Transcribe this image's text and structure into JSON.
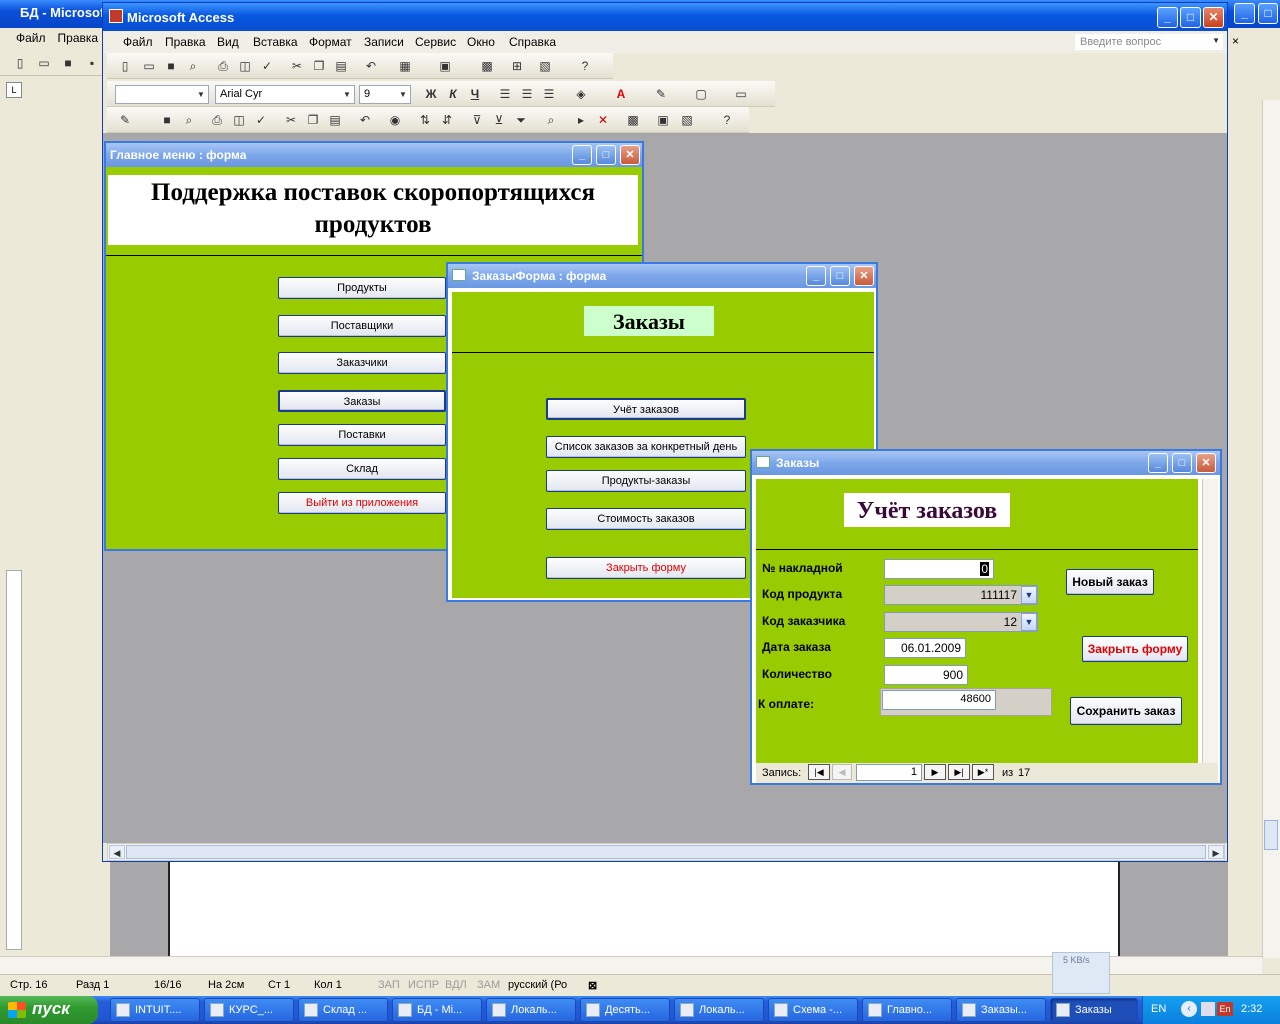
{
  "word": {
    "title": "БД - Microsof",
    "menu": [
      "Файл",
      "Правка"
    ],
    "status": {
      "page": "Стр. 16",
      "section": "Разд 1",
      "pages": "16/16",
      "at": "На 2см",
      "line": "Ст 1",
      "col": "Кол 1",
      "rec": "ЗАП",
      "trk": "ИСПР",
      "ext": "ВДЛ",
      "ovr": "ЗАМ",
      "lang": "русский (Ро"
    }
  },
  "access": {
    "title": "Microsoft Access",
    "menu": [
      "Файл",
      "Правка",
      "Вид",
      "Вставка",
      "Формат",
      "Записи",
      "Сервис",
      "Окно",
      "Справка"
    ],
    "search_placeholder": "Введите вопрос",
    "font_name": "Arial Cyr",
    "font_size": "9",
    "bold": "Ж",
    "italic": "К",
    "underline": "Ч"
  },
  "main_form": {
    "title": "Главное меню : форма",
    "heading": "Поддержка поставок скоропортящихся продуктов",
    "buttons": [
      "Продукты",
      "Поставщики",
      "Заказчики",
      "Заказы",
      "Поставки",
      "Склад",
      "Выйти из приложения"
    ]
  },
  "orders_form": {
    "title": "ЗаказыФорма : форма",
    "heading": "Заказы",
    "buttons": [
      "Учёт заказов",
      "Список заказов за конкретный день",
      "Продукты-заказы",
      "Стоимость заказов",
      "Закрыть форму"
    ]
  },
  "orders_window": {
    "title": "Заказы",
    "heading": "Учёт заказов",
    "labels": {
      "invoice": "№ накладной",
      "product": "Код продукта",
      "customer": "Код заказчика",
      "date": "Дата заказа",
      "qty": "Количество",
      "pay": "К оплате:"
    },
    "values": {
      "invoice": "0",
      "product": "111117",
      "customer": "12",
      "date": "06.01.2009",
      "qty": "900",
      "pay": "48600"
    },
    "buttons": {
      "new": "Новый заказ",
      "close": "Закрыть форму",
      "save": "Сохранить заказ"
    },
    "nav": {
      "label": "Запись:",
      "current": "1",
      "of": "из",
      "total": "17"
    }
  },
  "taskbar": {
    "start": "пуск",
    "tasks": [
      "INTUIT....",
      "КУРС_...",
      "Склад ...",
      "БД - Mi...",
      "Локаль...",
      "Десять...",
      "Локаль...",
      "Схема -...",
      "Главно...",
      "Заказы...",
      "Заказы"
    ],
    "lang": "EN",
    "time": "2:32",
    "speed": "5 KB/s"
  }
}
